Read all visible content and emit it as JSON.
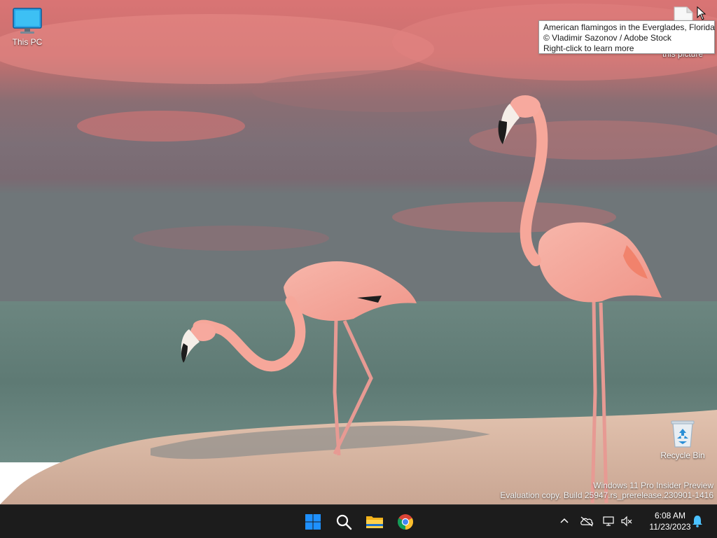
{
  "desktop": {
    "icons": [
      {
        "label": "This PC",
        "icon": "monitor-icon"
      },
      {
        "label": "this picture",
        "icon": "document-icon"
      },
      {
        "label": "Recycle Bin",
        "icon": "recycle-bin-icon"
      }
    ],
    "tooltip": {
      "line1": "American flamingos in the Everglades, Florida",
      "line2": "© Vladimir Sazonov / Adobe Stock",
      "line3": "Right-click to learn more"
    },
    "watermark": {
      "line1": "Windows 11 Pro Insider Preview",
      "line2": "Evaluation copy. Build 25947.rs_prerelease.230901-1416"
    }
  },
  "taskbar": {
    "apps": [
      {
        "name": "Start",
        "icon": "windows-logo-icon"
      },
      {
        "name": "Search",
        "icon": "search-icon"
      },
      {
        "name": "File Explorer",
        "icon": "folder-icon"
      },
      {
        "name": "Google Chrome",
        "icon": "chrome-icon"
      }
    ],
    "tray": [
      {
        "icon": "chevron-up-icon"
      },
      {
        "icon": "onedrive-offline-icon"
      },
      {
        "icon": "network-disconnected-icon"
      },
      {
        "icon": "speaker-muted-icon"
      },
      {
        "icon": "notification-bell-icon"
      }
    ],
    "clock": {
      "time": "6:08 AM",
      "date": "11/23/2023"
    }
  },
  "colors": {
    "sky_pink": "#e07a7e",
    "sky_gray": "#6e6e78",
    "sea": "#5e7a74",
    "sand": "#d8b7a3",
    "flamingo": "#f2a297",
    "taskbar": "#1c1c1c",
    "windows_blue": "#1e90ff",
    "bell_blue": "#4cc2ff"
  }
}
